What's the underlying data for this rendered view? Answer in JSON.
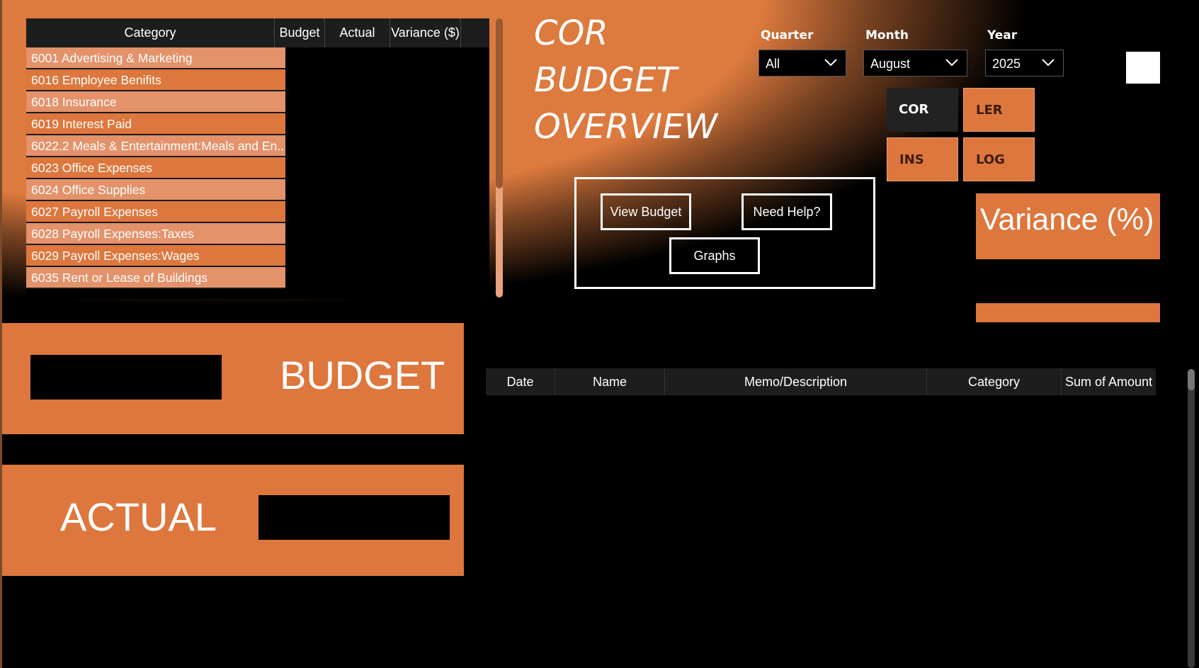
{
  "category_table": {
    "columns": [
      "Category",
      "Budget",
      "Actual",
      "Variance ($)"
    ],
    "rows": [
      "6001 Advertising & Marketing",
      "6016 Employee Benifits",
      "6018 Insurance",
      "6019 Interest Paid",
      "6022.2 Meals & Entertainment:Meals and En...",
      "6023 Office Expenses",
      "6024 Office Supplies",
      "6027 Payroll Expenses",
      "6028 Payroll Expenses:Taxes",
      "6029 Payroll Expenses:Wages",
      "6035 Rent or Lease of Buildings"
    ]
  },
  "title": {
    "line1": "COR",
    "line2": "BUDGET",
    "line3": "OVERVIEW"
  },
  "slicers": {
    "quarter": {
      "label": "Quarter",
      "value": "All"
    },
    "month": {
      "label": "Month",
      "value": "August"
    },
    "year": {
      "label": "Year",
      "value": "2025"
    }
  },
  "divisions": {
    "cor": "COR",
    "ler": "LER",
    "ins": "INS",
    "log": "LOG"
  },
  "nav": {
    "view_budget": "View Budget",
    "need_help": "Need Help?",
    "graphs": "Graphs"
  },
  "variance": {
    "label": "Variance (%)"
  },
  "kpi": {
    "budget_label": "BUDGET",
    "actual_label": "ACTUAL"
  },
  "transactions": {
    "columns": [
      "Date",
      "Name",
      "Memo/Description",
      "Category",
      "Sum of Amount"
    ]
  },
  "colors": {
    "accent": "#dd773d",
    "accent_light": "#e3926a",
    "header": "#1d1d1d",
    "background": "#000000"
  }
}
